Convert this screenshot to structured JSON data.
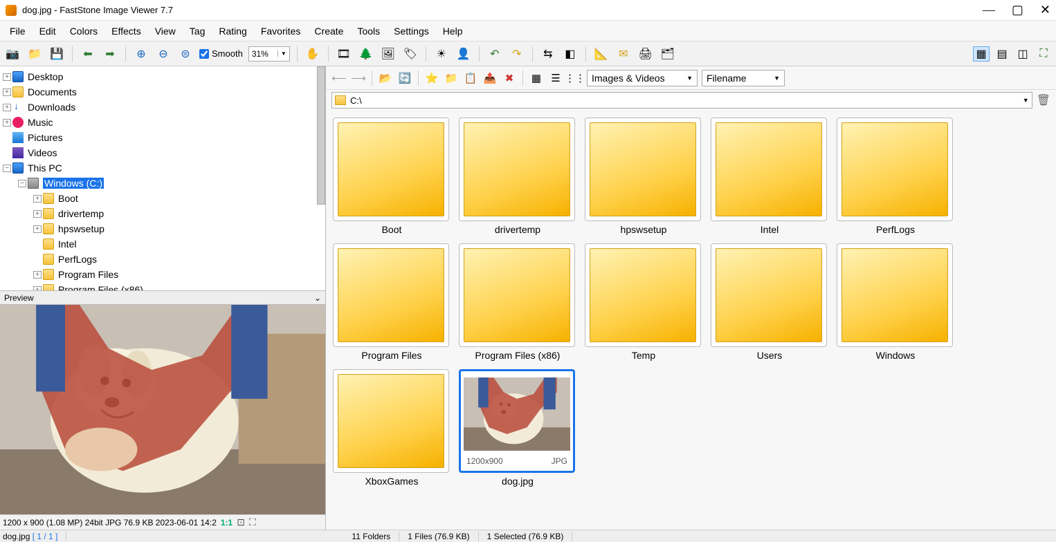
{
  "title": "dog.jpg  -  FastStone Image Viewer 7.7",
  "menu": [
    "File",
    "Edit",
    "Colors",
    "Effects",
    "View",
    "Tag",
    "Rating",
    "Favorites",
    "Create",
    "Tools",
    "Settings",
    "Help"
  ],
  "smooth_label": "Smooth",
  "zoom_value": "31%",
  "filter_label": "Images & Videos",
  "sort_label": "Filename",
  "address_path": "C:\\",
  "preview_header": "Preview",
  "preview_info": "1200 x 900 (1.08 MP)  24bit  JPG   76.9 KB   2023-06-01 14:2",
  "preview_ratio": "1:1",
  "tree": [
    {
      "label": "Desktop",
      "indent": 0,
      "exp": "+",
      "icon": "monitor"
    },
    {
      "label": "Documents",
      "indent": 0,
      "exp": "+",
      "icon": "folder"
    },
    {
      "label": "Downloads",
      "indent": 0,
      "exp": "+",
      "icon": "down"
    },
    {
      "label": "Music",
      "indent": 0,
      "exp": "+",
      "icon": "music"
    },
    {
      "label": "Pictures",
      "indent": 0,
      "exp": "",
      "icon": "pic"
    },
    {
      "label": "Videos",
      "indent": 0,
      "exp": "",
      "icon": "vid"
    },
    {
      "label": "This PC",
      "indent": 0,
      "exp": "−",
      "icon": "monitor"
    },
    {
      "label": "Windows (C:)",
      "indent": 1,
      "exp": "−",
      "icon": "drive",
      "selected": true
    },
    {
      "label": "Boot",
      "indent": 2,
      "exp": "+",
      "icon": "folder"
    },
    {
      "label": "drivertemp",
      "indent": 2,
      "exp": "+",
      "icon": "folder"
    },
    {
      "label": "hpswsetup",
      "indent": 2,
      "exp": "+",
      "icon": "folder"
    },
    {
      "label": "Intel",
      "indent": 2,
      "exp": "",
      "icon": "folder"
    },
    {
      "label": "PerfLogs",
      "indent": 2,
      "exp": "",
      "icon": "folder"
    },
    {
      "label": "Program Files",
      "indent": 2,
      "exp": "+",
      "icon": "folder"
    },
    {
      "label": "Program Files (x86)",
      "indent": 2,
      "exp": "+",
      "icon": "folder"
    }
  ],
  "thumbs": [
    {
      "label": "Boot",
      "type": "folder"
    },
    {
      "label": "drivertemp",
      "type": "folder"
    },
    {
      "label": "hpswsetup",
      "type": "folder"
    },
    {
      "label": "Intel",
      "type": "folder"
    },
    {
      "label": "PerfLogs",
      "type": "folder"
    },
    {
      "label": "Program Files",
      "type": "folder"
    },
    {
      "label": "Program Files (x86)",
      "type": "folder"
    },
    {
      "label": "Temp",
      "type": "folder"
    },
    {
      "label": "Users",
      "type": "folder"
    },
    {
      "label": "Windows",
      "type": "folder"
    },
    {
      "label": "XboxGames",
      "type": "folder"
    },
    {
      "label": "dog.jpg",
      "type": "image",
      "selected": true,
      "dim": "1200x900",
      "fmt": "JPG"
    }
  ],
  "status": {
    "file": "dog.jpg",
    "pos": "[ 1 / 1 ]",
    "folders": "11 Folders",
    "files": "1 Files (76.9 KB)",
    "selected": "1 Selected (76.9 KB)"
  }
}
